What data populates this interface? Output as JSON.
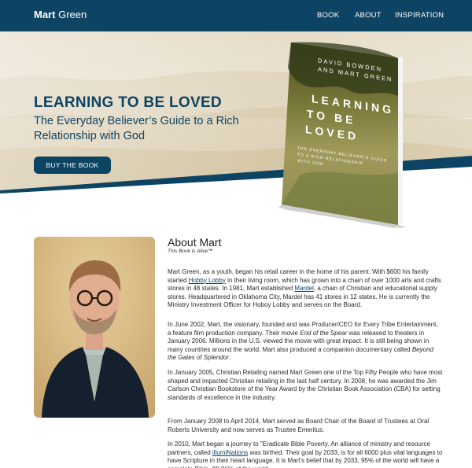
{
  "header": {
    "brand_first": "Mart",
    "brand_last": "Green",
    "nav": [
      "BOOK",
      "ABOUT",
      "INSPIRATION"
    ]
  },
  "hero": {
    "title": "LEARNING TO BE LOVED",
    "subtitle": "The Everyday Believer’s Guide to a Rich Relationship with God",
    "button": "BUY THE BOOK"
  },
  "book": {
    "authors_line1": "DAVID BOWDEN",
    "authors_line2": "AND MART GREEN",
    "title_line1": "LEARNING",
    "title_line2": "TO BE",
    "title_line3": "LOVED",
    "subtitle_line1": "THE EVERYDAY BELIEVER'S GUIDE",
    "subtitle_line2": "TO A RICH RELATIONSHIP",
    "subtitle_line3": "WITH GOD"
  },
  "about": {
    "heading": "About Mart",
    "tagline": "This Book is Alive™",
    "p1_a": "Mart Green, as a youth, began his retail career in the home of his parent. With $600 his family started ",
    "p1_link1": "Hobby Lobby",
    "p1_b": " in their living room, which has grown into a chain of over 1000 arts and crafts stores in 48 states. In 1981, Mart established ",
    "p1_link2": "Mardel",
    "p1_c": ", a chain of Christian and educational supply stores. Headquartered in Oklahoma City, Mardel has 41 stores in 12 states. He is currently the Ministry Investment Officer for Hoboy Lobby and serves on the Board.",
    "p2_a": "In June 2002, Mart, the visionary, founded and was Producer/CEO for Every Tribe Entertainment, a feature film production company. Their movie ",
    "p2_em1": "End of the Spear",
    "p2_b": " was released to theaters in January 2006. Millions in the U.S. viewed the movie with great impact. It is still being shown in many countries around the world. Mart also produced a companion documentary called ",
    "p2_em2": "Beyond the Gates of Splendor",
    "p2_c": ".",
    "p3": "In January 2005, Christian Retailing named Mart Green one of the Top Fifty People who have most shaped and impacted Christian retailing in the last half century. In 2008, he was awarded the Jim Carlson Christian Bookstore of the Year Award by the Christian Book Association (CBA) for setting standards of excellence in the industry.",
    "p4": "From January 2008 to April 2014, Mart served as Board Chair of the Board of Trustees at Oral Roberts University and now serves as Trustee Emeritus.",
    "p5_a": "In 2010, Mart began a journey to \"Eradicate Bible Poverty. An alliance of ministry and resource partners, called ",
    "p5_link": "illumiNations",
    "p5_b": " was birthed. Their goal by 2033, is for all 6000 plus vital languages to have Scripture in their heart language. It is Mart's belief that by 2033, 95% of the world will have a complete Bible, 99.96% of the world"
  },
  "colors": {
    "brand_navy": "#0e4463",
    "link": "#0e4463"
  }
}
